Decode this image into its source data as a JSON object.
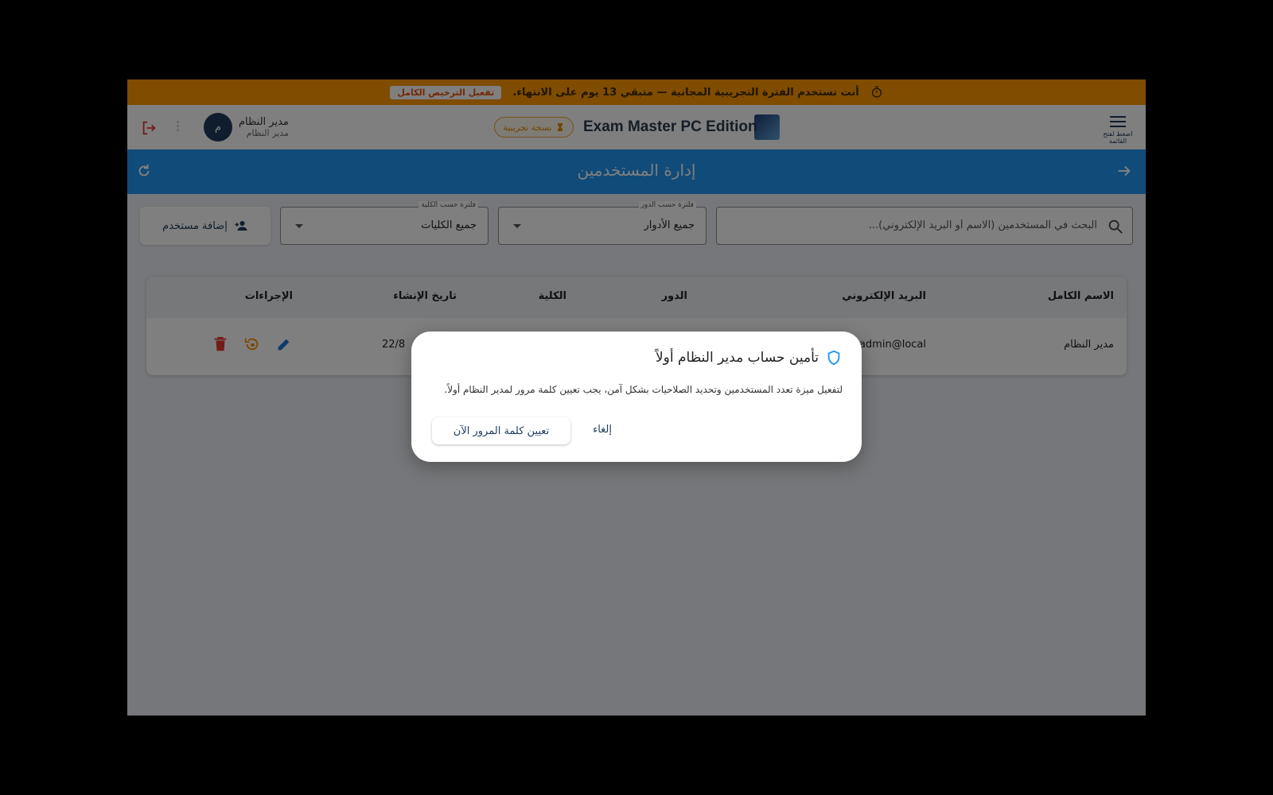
{
  "trial_banner": {
    "message": "أنت تستخدم الفترة التجريبية المجانية — متبقي 13 يوم على الانتهاء.",
    "activate_label": "تفعيل الترخيص الكامل",
    "timer_icon": "timer-icon"
  },
  "topbar": {
    "menu_label": "اضغط لفتح القائمة",
    "app_title": "Exam Master PC Edition",
    "trial_chip_label": "نسخة تجريبية",
    "user_name": "مدير النظام",
    "user_role": "مدير النظام",
    "avatar_initial": "م"
  },
  "page_header": {
    "title": "إدارة المستخدمين"
  },
  "filters": {
    "search_placeholder": "البحث في المستخدمين (الاسم أو البريد الإلكتروني)...",
    "role_filter": {
      "label": "فلترة حسب الدور",
      "value": "جميع الأدوار"
    },
    "college_filter": {
      "label": "فلترة حسب الكلية",
      "value": "جميع الكليات"
    },
    "add_user_label": "إضافة مستخدم"
  },
  "table": {
    "columns": [
      "الاسم الكامل",
      "البريد الإلكتروني",
      "الدور",
      "الكلية",
      "تاريخ الإنشاء",
      "الإجراءات"
    ],
    "rows": [
      {
        "full_name": "مدير النظام",
        "email": "admin@local",
        "role": "",
        "college": "",
        "created": "22/8"
      }
    ]
  },
  "dialog": {
    "title": "تأمين حساب مدير النظام أولاً",
    "message": "لتفعيل ميزة تعدد المستخدمين وتحديد الصلاحيات بشكل آمن، يجب تعيين كلمة مرور لمدير النظام أولاً.",
    "primary_label": "تعيين كلمة المرور الآن",
    "cancel_label": "إلغاء"
  },
  "colors": {
    "banner": "#ff9800",
    "header": "#2196f3",
    "navy": "#1f3b5c",
    "delete": "#e53935",
    "reset": "#fb8c00",
    "edit": "#1976d2"
  }
}
